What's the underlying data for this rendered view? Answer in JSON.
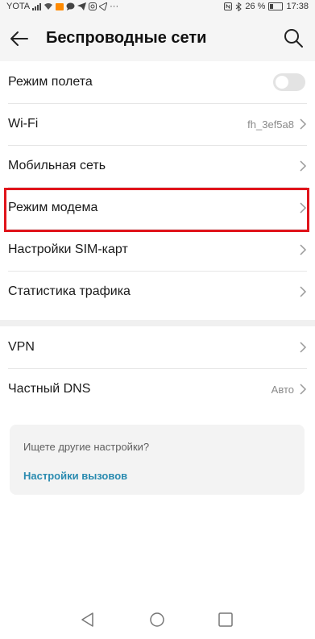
{
  "status_bar": {
    "carrier": "YOTA",
    "battery": "26 %",
    "time": "17:38"
  },
  "header": {
    "title": "Беспроводные сети",
    "icons": [
      "arrow-left-icon",
      "search-icon"
    ]
  },
  "group1": {
    "airplane": {
      "label": "Режим полета",
      "enabled": false
    },
    "wifi": {
      "label": "Wi-Fi",
      "value": "fh_3ef5a8"
    },
    "mobile": {
      "label": "Мобильная сеть"
    },
    "tethering": {
      "label": "Режим модема"
    },
    "sim": {
      "label": "Настройки SIM-карт"
    },
    "traffic": {
      "label": "Статистика трафика"
    }
  },
  "group2": {
    "vpn": {
      "label": "VPN"
    },
    "dns": {
      "label": "Частный DNS",
      "value": "Авто"
    }
  },
  "suggest": {
    "question": "Ищете другие настройки?",
    "link": "Настройки вызовов"
  },
  "colors": {
    "highlight": "#e0141b",
    "link": "#2a8bb0",
    "toggle_off": "#e3e3e3"
  }
}
